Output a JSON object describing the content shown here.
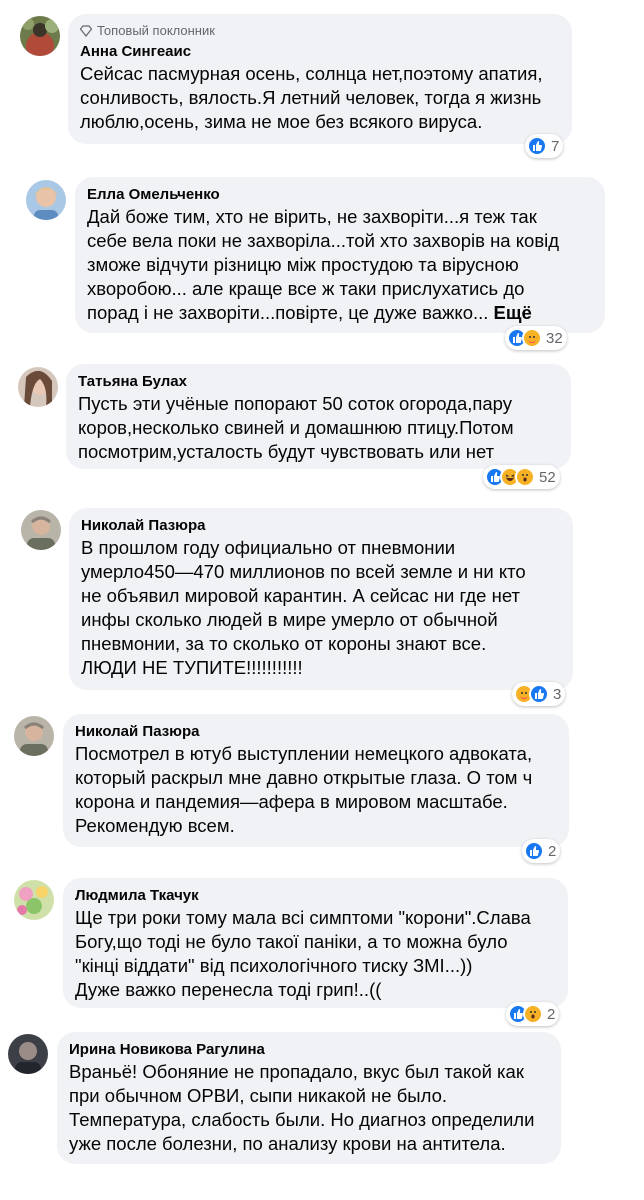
{
  "comments": [
    {
      "badge": "Топовый поклонник",
      "name": "Анна Сингеаис",
      "text": "Сейсас пасмурная осень, солнца нет,поэтому апатия,\nсонливость, вялость.Я летний человек, тогда я жизнь\nлюблю,осень, зима не мое без всякого вируса.",
      "reaction_icons": [
        "like-icon"
      ],
      "reaction_count": "7"
    },
    {
      "name": "Елла Омельченко",
      "text": "Дай боже тим, хто не вірить, не захворіти...я теж так\nсебе вела поки не захворіла...той хто захворів на ковід\nзможе відчути різницю між простудою та вірусною\nхворобою... але краще все ж таки прислухатись до\nпорад і не захворіти...повірте, це дуже важко...",
      "more": "Ещё",
      "reaction_icons": [
        "like-icon",
        "care-icon"
      ],
      "reaction_count": "32"
    },
    {
      "name": "Татьяна Булах",
      "text": "Пусть эти учёные попорают 50 соток огорода,пару\nкоров,несколько свиней и домашнюю птицу.Потом\nпосмотрим,усталость будут чувствовать или нет",
      "reaction_icons": [
        "like-icon",
        "haha-icon",
        "wow-icon"
      ],
      "reaction_count": "52"
    },
    {
      "name": "Николай Пазюра",
      "text": "В прошлом году официально от пневмонии\nумерло450—470 миллионов по всей земле и ни кто\nне объявил мировой карантин. А сейсас ни где нет\nинфы сколько людей в мире умерло от обычной\nпневмонии, за то сколько от короны знают все.\nЛЮДИ НЕ ТУПИТЕ!!!!!!!!!!!",
      "reaction_icons": [
        "care-icon",
        "like-icon"
      ],
      "reaction_count": "3"
    },
    {
      "name": "Николай Пазюра",
      "text": "Посмотрел в ютуб выступлении немецкого адвоката,\nкоторый раскрыл мне давно открытые глаза. О том ч\nкорона и пандемия—афера в мировом масштабе.\nРекомендую всем.",
      "reaction_icons": [
        "like-icon"
      ],
      "reaction_count": "2"
    },
    {
      "name": "Людмила Ткачук",
      "text": "Ще три роки тому мала всі симптоми \"корони\".Слава\nБогу,що тоді не було такої паніки, а то можна було\n\"кінці віддати\" від психологічного тиску ЗМІ...))\nДуже важко перенесла тоді грип!..((",
      "reaction_icons": [
        "like-icon",
        "wow-icon"
      ],
      "reaction_count": "2"
    },
    {
      "name": "Ирина Новикова Рагулина",
      "text": "Враньё! Обоняние не пропадало, вкус был такой как\nпри обычном ОРВИ, сыпи никакой не было.\nТемпература, слабость были. Но диагноз определили\nуже после болезни, по анализу крови на антитела."
    }
  ],
  "colors": {
    "bubble": "#f0f2f5",
    "like": "#1877f2",
    "emoji": "#f7b125",
    "meta": "#65676b"
  }
}
